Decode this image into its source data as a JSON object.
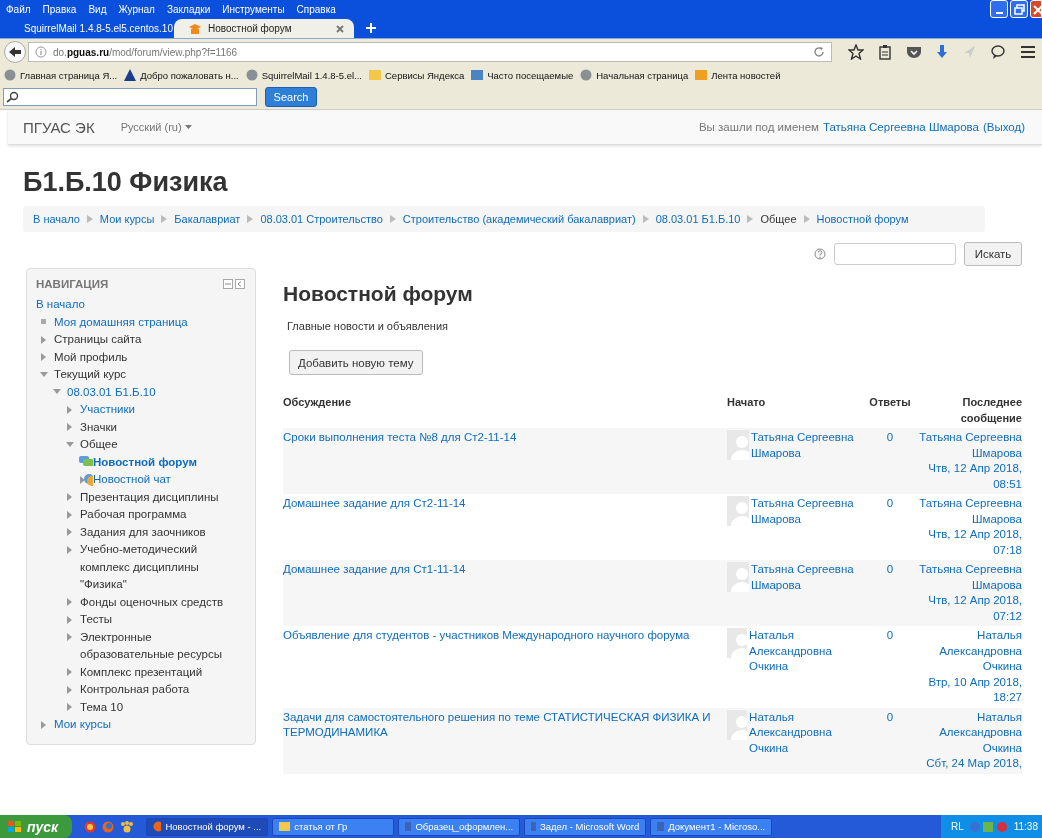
{
  "browser": {
    "menu": [
      "Файл",
      "Правка",
      "Вид",
      "Журнал",
      "Закладки",
      "Инструменты",
      "Справка"
    ],
    "tabs": [
      {
        "label": "SquirrelMail 1.4.8-5.el5.centos.10",
        "selected": false,
        "kind": "mail"
      },
      {
        "label": "Новостной форум",
        "selected": true,
        "kind": "moodle"
      }
    ],
    "address": "do.**pguas.ru**/mod/forum/view.php?f=1166",
    "bookmarks": [
      {
        "label": "Главная страница Я...",
        "kind": "globe"
      },
      {
        "label": "Добро пожаловать н...",
        "kind": "logo"
      },
      {
        "label": "SquirrelMail 1.4.8-5.el...",
        "kind": "globe"
      },
      {
        "label": "Сервисы Яндекса",
        "kind": "folder"
      },
      {
        "label": "Часто посещаемые",
        "kind": "search"
      },
      {
        "label": "Начальная страница",
        "kind": "globe"
      },
      {
        "label": "Лента новостей",
        "kind": "rss"
      }
    ],
    "search_button": "Search"
  },
  "site": {
    "brand": "ПГУАС ЭК",
    "language": "Русский (ru)",
    "login_prefix": "Вы зашли под именем",
    "user": "Татьяна Сергеевна Шмарова",
    "logout": "(Выход)"
  },
  "course_title": "Б1.Б.10 Физика",
  "breadcrumb": [
    {
      "label": "В начало",
      "link": true
    },
    {
      "label": "Мои курсы",
      "link": true
    },
    {
      "label": "Бакалавриат",
      "link": true
    },
    {
      "label": "08.03.01 Строительство",
      "link": true
    },
    {
      "label": "Строительство (академический бакалавриат)",
      "link": true
    },
    {
      "label": "08.03.01 Б1.Б.10",
      "link": true
    },
    {
      "label": "Общее",
      "link": false
    },
    {
      "label": "Новостной форум",
      "link": true
    }
  ],
  "search_button": "Искать",
  "navigation": {
    "title": "НАВИГАЦИЯ",
    "items": [
      {
        "label": "В начало",
        "kind": "plain",
        "link": true,
        "current": false
      },
      {
        "label": "Моя домашняя страница",
        "kind": "bullet",
        "link": true,
        "current": false
      },
      {
        "label": "Страницы сайта",
        "kind": "branch",
        "expanded": false,
        "link": false,
        "current": false
      },
      {
        "label": "Мой профиль",
        "kind": "branch",
        "expanded": false,
        "link": false,
        "current": false
      },
      {
        "label": "Текущий курс",
        "kind": "branch",
        "expanded": true,
        "link": false,
        "current": false,
        "children": [
          {
            "label": "08.03.01 Б1.Б.10",
            "kind": "branch",
            "expanded": true,
            "link": true,
            "current": false,
            "children": [
              {
                "label": "Участники",
                "kind": "branch",
                "expanded": false,
                "link": true,
                "current": false
              },
              {
                "label": "Значки",
                "kind": "branch",
                "expanded": false,
                "link": false,
                "current": false
              },
              {
                "label": "Общее",
                "kind": "branch",
                "expanded": true,
                "link": false,
                "current": false,
                "children": [
                  {
                    "label": "Новостной форум",
                    "kind": "forum",
                    "link": true,
                    "current": true
                  },
                  {
                    "label": "Новостной чат",
                    "kind": "chat",
                    "link": true,
                    "current": false
                  }
                ]
              },
              {
                "label": "Презентация дисциплины",
                "kind": "branch",
                "expanded": false,
                "link": false,
                "current": false
              },
              {
                "label": "Рабочая программа",
                "kind": "branch",
                "expanded": false,
                "link": false,
                "current": false
              },
              {
                "label": "Задания для заочников",
                "kind": "branch",
                "expanded": false,
                "link": false,
                "current": false
              },
              {
                "label": "Учебно-методический комплекс дисциплины \"Физика\"",
                "kind": "branch",
                "expanded": false,
                "link": false,
                "current": false
              },
              {
                "label": "Фонды оценочных средств",
                "kind": "branch",
                "expanded": false,
                "link": false,
                "current": false
              },
              {
                "label": "Тесты",
                "kind": "branch",
                "expanded": false,
                "link": false,
                "current": false
              },
              {
                "label": "Электронные образовательные ресурсы",
                "kind": "branch",
                "expanded": false,
                "link": false,
                "current": false
              },
              {
                "label": "Комплекс презентаций",
                "kind": "branch",
                "expanded": false,
                "link": false,
                "current": false
              },
              {
                "label": "Контрольная работа",
                "kind": "branch",
                "expanded": false,
                "link": false,
                "current": false
              },
              {
                "label": "Тема 10",
                "kind": "branch",
                "expanded": false,
                "link": false,
                "current": false
              }
            ]
          }
        ]
      },
      {
        "label": "Мои курсы",
        "kind": "branch",
        "expanded": false,
        "link": true,
        "current": false
      }
    ]
  },
  "forum": {
    "title": "Новостной форум",
    "description": "Главные новости и объявления",
    "add_button": "Добавить новую тему",
    "columns": [
      "Обсуждение",
      "Начато",
      "Ответы",
      "Последнее сообщение"
    ],
    "rows": [
      {
        "subject": "Сроки выполнения теста №8 для Ст2-11-14",
        "author": "Татьяна Сергеевна Шмарова",
        "replies": "0",
        "last_author": "Татьяна Сергеевна Шмарова",
        "last_date": "Чтв, 12 Апр 2018, 08:51"
      },
      {
        "subject": "Домашнее задание для Ст2-11-14",
        "author": "Татьяна Сергеевна Шмарова",
        "replies": "0",
        "last_author": "Татьяна Сергеевна Шмарова",
        "last_date": "Чтв, 12 Апр 2018, 07:18"
      },
      {
        "subject": "Домашнее задание для Ст1-11-14",
        "author": "Татьяна Сергеевна Шмарова",
        "replies": "0",
        "last_author": "Татьяна Сергеевна Шмарова",
        "last_date": "Чтв, 12 Апр 2018, 07:12"
      },
      {
        "subject": "Объявление для студентов - участников Международного научного форума",
        "author": "Наталья Александровна Очкина",
        "replies": "0",
        "last_author": "Наталья Александровна Очкина",
        "last_date": "Втр, 10 Апр 2018, 18:27"
      },
      {
        "subject": "Задачи для самостоятельного решения по теме СТАТИСТИЧЕСКАЯ ФИЗИКА И ТЕРМОДИНАМИКА",
        "author": "Наталья Александровна Очкина",
        "replies": "0",
        "last_author": "Наталья Александровна Очкина",
        "last_date": "Сбт, 24 Мар 2018,"
      }
    ]
  },
  "taskbar": {
    "start": "пуск",
    "tasks": [
      {
        "label": "Новостной форум - ...",
        "kind": "browser",
        "selected": true
      },
      {
        "label": "статья от Гр",
        "kind": "folder",
        "selected": false
      },
      {
        "label": "Образец_оформлен...",
        "kind": "word",
        "selected": false
      },
      {
        "label": "Задел - Microsoft Word",
        "kind": "word",
        "selected": false
      },
      {
        "label": "Документ1 - Microso...",
        "kind": "word",
        "selected": false
      }
    ],
    "tray_text": "RL",
    "clock": "11:38"
  }
}
